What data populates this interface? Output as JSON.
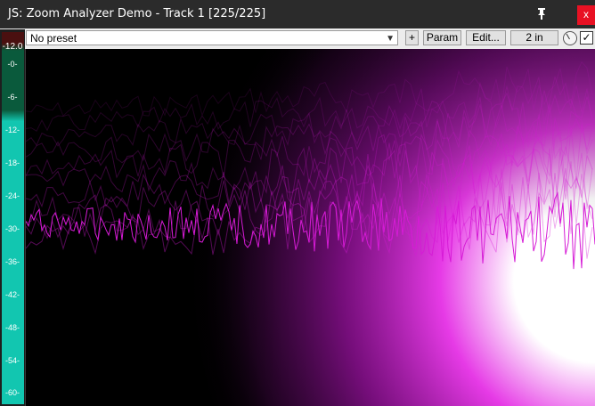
{
  "window": {
    "title": "JS: Zoom Analyzer Demo - Track 1 [225/225]",
    "pin_icon": "pin-icon",
    "close_label": "x"
  },
  "toolbar": {
    "preset_value": "No preset",
    "add_label": "+",
    "param_label": "Param",
    "edit_label": "Edit...",
    "io_label": "2 in",
    "knob_icon": "knob-icon",
    "enabled_checked": true
  },
  "meter": {
    "peak": "-12.0",
    "labels": [
      "-0-",
      "-6-",
      "-12-",
      "-18-",
      "-24-",
      "-30-",
      "-36-",
      "-42-",
      "-48-",
      "-54-",
      "-60-"
    ],
    "colors": {
      "top": "#4a1010",
      "green": "#0a5a3c",
      "teal": "#12c6b0"
    }
  },
  "analyzer": {
    "accent": "#d61bd6",
    "hot": "#ffffff",
    "background": "#000000"
  }
}
